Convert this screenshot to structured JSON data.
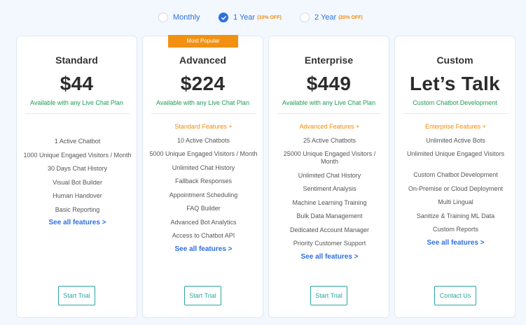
{
  "billing": {
    "options": [
      {
        "label": "Monthly",
        "discount": "",
        "selected": false
      },
      {
        "label": "1 Year",
        "discount": "(10% OFF)",
        "selected": true
      },
      {
        "label": "2 Year",
        "discount": "(20% OFF)",
        "selected": false
      }
    ]
  },
  "colors": {
    "accent_blue": "#2f6fe0",
    "accent_orange": "#f28a0c",
    "green": "#1f9a55",
    "teal": "#2aa7a0",
    "background": "#f2f8fd"
  },
  "plans": [
    {
      "name": "Standard",
      "price": "$44",
      "availability": "Available with any Live Chat Plan",
      "badge": "",
      "tier_heading": "",
      "features": [
        "1 Active Chatbot",
        "1000 Unique Engaged Visitors / Month",
        "30 Days Chat History",
        "Visual Bot Builder",
        "Human Handover",
        "Basic Reporting"
      ],
      "see_all": "See all features >",
      "cta": "Start Trial"
    },
    {
      "name": "Advanced",
      "price": "$224",
      "availability": "Available with any Live Chat Plan",
      "badge": "Most Popular",
      "tier_heading": "Standard Features +",
      "features": [
        "10 Active Chatbots",
        "5000 Unique Engaged Visitors / Month",
        "Unlimited Chat History",
        "Fallback Responses",
        "Appointment Scheduling",
        "FAQ Builder",
        "Advanced Bot Analytics",
        "Access to Chatbot API"
      ],
      "see_all": "See all features >",
      "cta": "Start Trial"
    },
    {
      "name": "Enterprise",
      "price": "$449",
      "availability": "Available with any Live Chat Plan",
      "badge": "",
      "tier_heading": "Advanced Features +",
      "features": [
        "25 Active Chatbots",
        "25000 Unique Engaged Visitors / Month",
        "Unlimited Chat History",
        "Sentiment Analysis",
        "Machine Learning Training",
        "Bulk Data Management",
        "Dedicated Account Manager",
        "Priority Customer Support"
      ],
      "see_all": "See all features >",
      "cta": "Start Trial"
    },
    {
      "name": "Custom",
      "price": "Let’s Talk",
      "availability": "Custom Chatbot Development",
      "badge": "",
      "tier_heading": "Enterprise Features +",
      "features": [
        "Unlimited Active Bots",
        "Unlimited Unique Engaged Visitors",
        "Custom Chatbot Development",
        "On-Premise or Cloud Deployment",
        "Multi Lingual",
        "Sanitize & Training ML Data",
        "Custom Reports"
      ],
      "see_all": "See all features >",
      "cta": "Contact Us"
    }
  ]
}
